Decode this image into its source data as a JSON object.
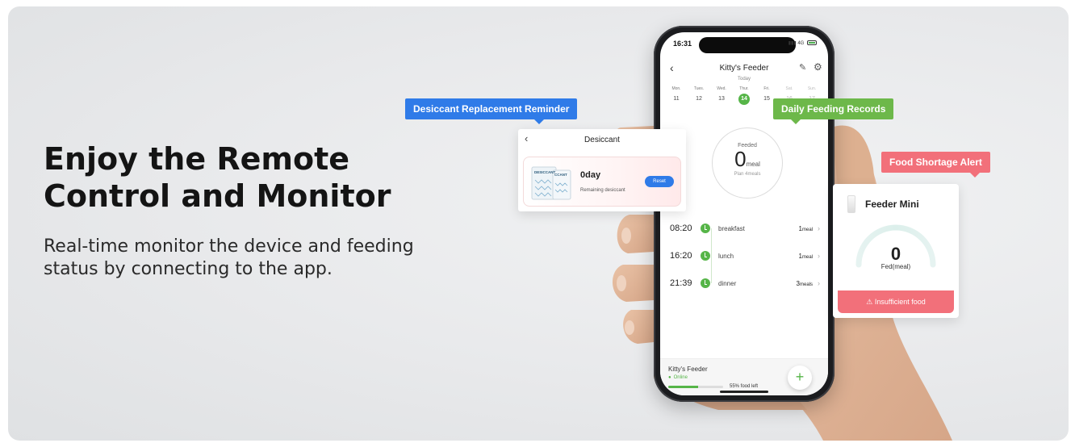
{
  "headline": {
    "line1": "Enjoy the Remote",
    "line2": "Control and Monitor"
  },
  "subline": {
    "line1": "Real-time monitor the device and feeding",
    "line2": "status by connecting to the app."
  },
  "tags": {
    "desiccant": "Desiccant Replacement Reminder",
    "feeding": "Daily Feeding Records",
    "shortage": "Food Shortage Alert"
  },
  "phone": {
    "status_time": "16:31",
    "status_net": "4G",
    "app_title": "Kitty's Feeder",
    "today_label": "Today",
    "week": [
      {
        "name": "Mon.",
        "date": "11",
        "state": "past"
      },
      {
        "name": "Tues.",
        "date": "12",
        "state": "past"
      },
      {
        "name": "Wed.",
        "date": "13",
        "state": "past"
      },
      {
        "name": "Thur.",
        "date": "14",
        "state": "active"
      },
      {
        "name": "Fri.",
        "date": "15",
        "state": "past"
      },
      {
        "name": "Sat.",
        "date": "16",
        "state": "future"
      },
      {
        "name": "Sun.",
        "date": "17",
        "state": "future"
      }
    ],
    "feeded_label": "Feeded",
    "feeded_value": "0",
    "feeded_unit": "meal",
    "plan_text": "Plan 4meals",
    "meals": [
      {
        "time": "08:20",
        "name": "breakfast",
        "qty": "1",
        "unit": "meal"
      },
      {
        "time": "16:20",
        "name": "lunch",
        "qty": "1",
        "unit": "meal"
      },
      {
        "time": "21:39",
        "name": "dinner",
        "qty": "3",
        "unit": "meals"
      }
    ],
    "device_name": "Kitty's Feeder",
    "device_status": "Online",
    "food_left_text": "55% food left",
    "food_left_fraction": 0.55
  },
  "desiccant": {
    "title": "Desiccant",
    "value": "0day",
    "sub": "Remaining desiccant",
    "reset": "Reset",
    "pack_label_1": "DESICCANT",
    "pack_label_2": "CCANT"
  },
  "mini": {
    "title": "Feeder Mini",
    "value": "0",
    "label": "Fed(meal)",
    "alert": "Insufficient food"
  },
  "colors": {
    "accent_green": "#56b548",
    "tag_blue": "#2f7be8",
    "tag_green": "#6db84a",
    "tag_red": "#f2707a"
  }
}
